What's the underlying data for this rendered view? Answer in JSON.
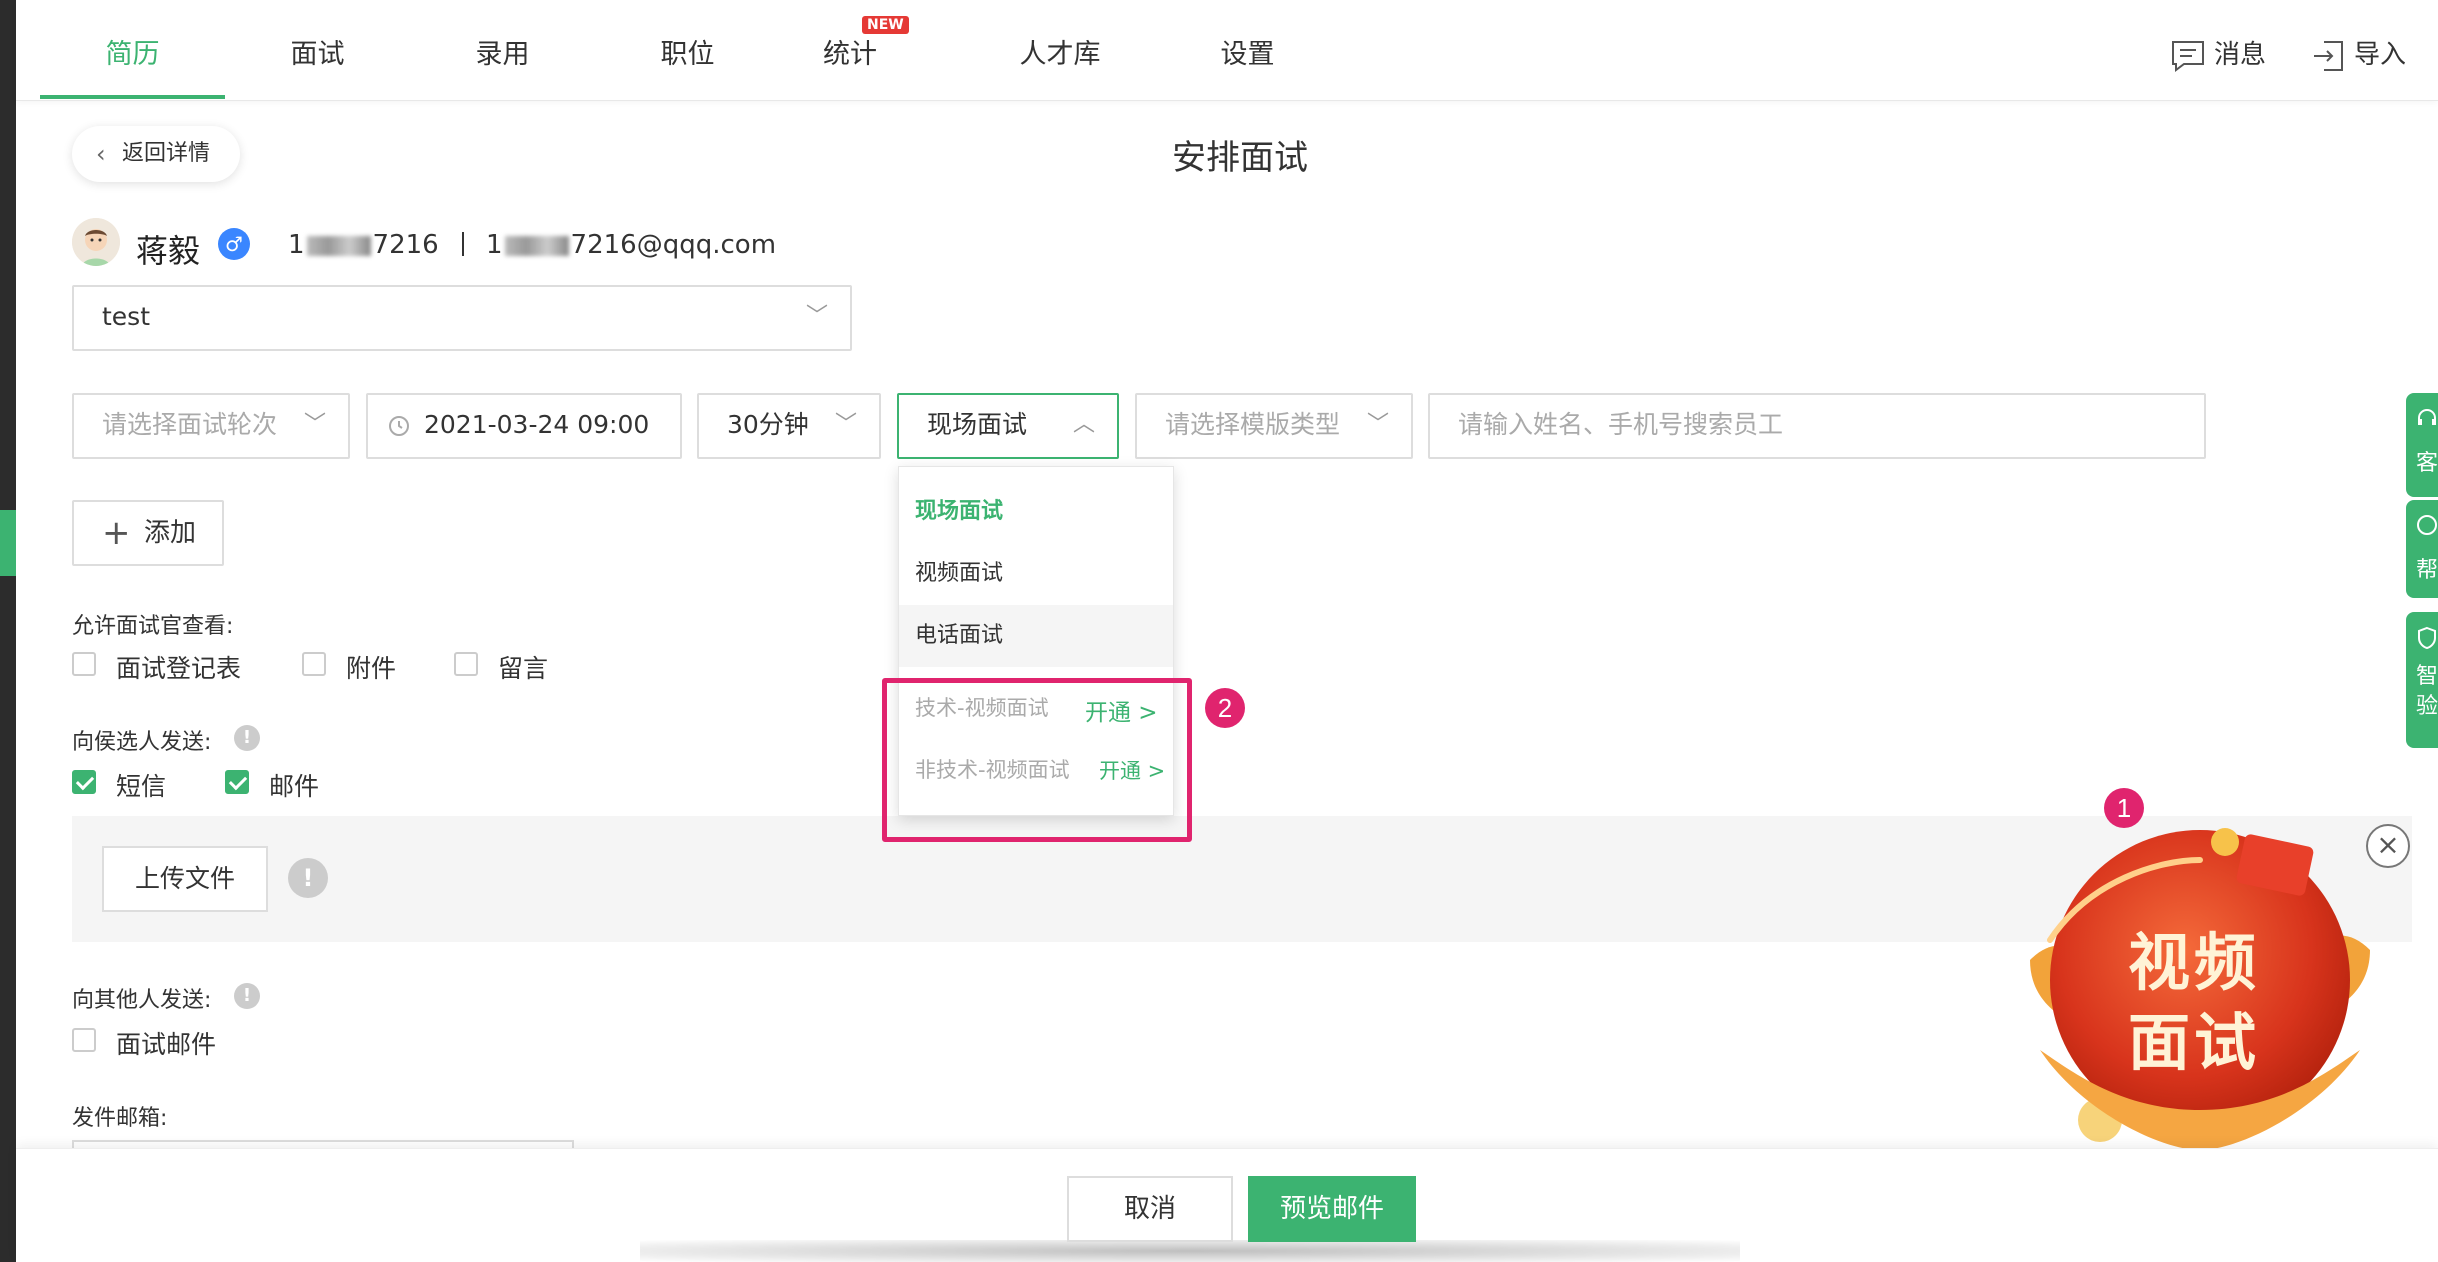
{
  "nav": {
    "items": [
      {
        "label": "简历",
        "active": true
      },
      {
        "label": "面试",
        "active": false
      },
      {
        "label": "录用",
        "active": false
      },
      {
        "label": "职位",
        "active": false
      },
      {
        "label": "统计",
        "active": false
      },
      {
        "label": "人才库",
        "active": false
      },
      {
        "label": "设置",
        "active": false
      }
    ],
    "new_badge": "NEW",
    "messages_label": "消息",
    "import_label": "导入"
  },
  "back_button": "返回详情",
  "page_title": "安排面试",
  "candidate": {
    "name": "蒋毅",
    "gender_symbol": "♂",
    "phone_prefix": "1",
    "phone_suffix": "7216",
    "email_prefix": "1",
    "email_suffix": "7216@qqq.com"
  },
  "position_select": {
    "value": "test"
  },
  "form": {
    "round_placeholder": "请选择面试轮次",
    "datetime": "2021-03-24 09:00",
    "duration": "30分钟",
    "interview_type": "现场面试",
    "template_placeholder": "请选择模版类型",
    "employee_placeholder": "请输入姓名、手机号搜索员工",
    "add_label": "添加"
  },
  "dropdown": {
    "options": [
      {
        "label": "现场面试",
        "state": "selected"
      },
      {
        "label": "视频面试",
        "state": "normal"
      },
      {
        "label": "电话面试",
        "state": "hover"
      }
    ],
    "locked_options": [
      {
        "label": "技术-视频面试",
        "action": "开通 >"
      },
      {
        "label": "非技术-视频面试",
        "action": "开通 >"
      }
    ]
  },
  "interviewer_view": {
    "title": "允许面试官查看:",
    "options": [
      {
        "label": "面试登记表",
        "checked": false
      },
      {
        "label": "附件",
        "checked": false
      },
      {
        "label": "留言",
        "checked": false
      }
    ]
  },
  "send_to_candidate": {
    "title": "向侯选人发送:",
    "options": [
      {
        "label": "短信",
        "checked": true
      },
      {
        "label": "邮件",
        "checked": true
      }
    ]
  },
  "upload": {
    "button_label": "上传文件",
    "info_icon": "!"
  },
  "send_to_others": {
    "title": "向其他人发送:",
    "options": [
      {
        "label": "面试邮件",
        "checked": false
      }
    ]
  },
  "sender_mailbox_label": "发件邮箱:",
  "markers": {
    "one": "1",
    "two": "2"
  },
  "side_tabs": [
    {
      "label": "客"
    },
    {
      "label": "帮"
    },
    {
      "label": "智验"
    }
  ],
  "promo": {
    "line1": "视频",
    "line2": "面试"
  },
  "footer": {
    "cancel_label": "取消",
    "preview_label": "预览邮件"
  },
  "colors": {
    "accent": "#3cb371",
    "highlight": "#e0246e",
    "badge": "#e53935"
  }
}
